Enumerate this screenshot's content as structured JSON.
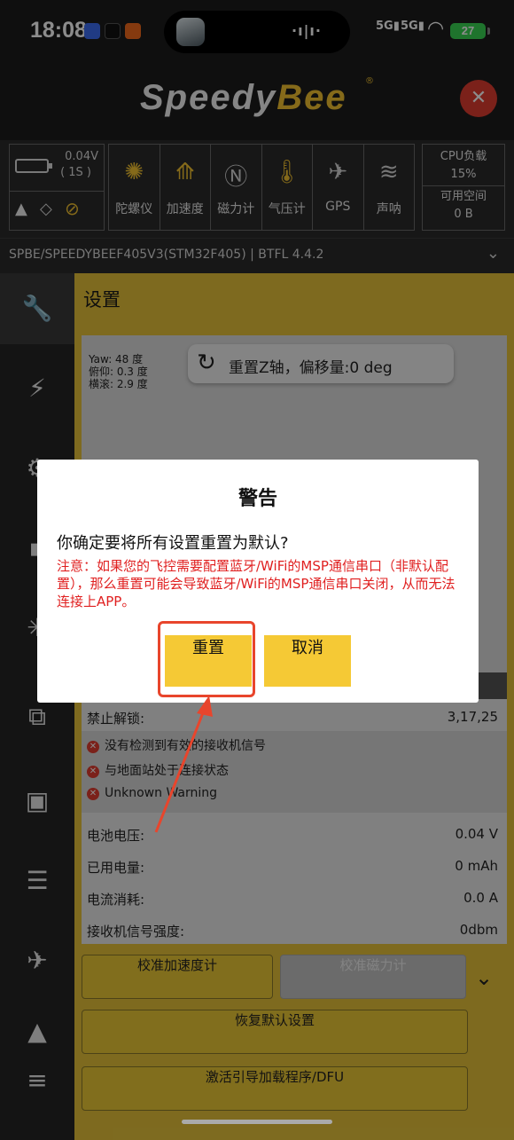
{
  "status": {
    "time": "18:08",
    "signal1": "5G",
    "signal2": "5G",
    "battery": "27"
  },
  "header": {
    "logo_part1": "Speedy",
    "logo_part2": "Bee",
    "logo_reg": "®"
  },
  "sensors": {
    "battery_voltage": "0.04V",
    "battery_cells": "( 1S )",
    "items": [
      {
        "label": "陀螺仪",
        "icon": "gyro-icon",
        "active": true
      },
      {
        "label": "加速度",
        "icon": "accelerometer-icon",
        "active": true
      },
      {
        "label": "磁力计",
        "icon": "compass-icon",
        "active": false
      },
      {
        "label": "气压计",
        "icon": "barometer-icon",
        "active": true
      },
      {
        "label": "GPS",
        "icon": "satellite-icon",
        "active": false
      },
      {
        "label": "声呐",
        "icon": "sonar-icon",
        "active": false
      }
    ],
    "cpu_label": "CPU负载",
    "cpu_value": "15%",
    "space_label": "可用空间",
    "space_value": "0 B"
  },
  "device": {
    "info": "SPBE/SPEEDYBEEF405V3(STM32F405) | BTFL 4.4.2"
  },
  "main": {
    "title": "设置",
    "yaw": "Yaw: 48 度",
    "pitch": "俯仰: 0.3 度",
    "roll": "横滚: 2.9 度",
    "reset_z": "重置Z轴，偏移量:0 deg",
    "arming_label": "禁止解锁:",
    "arming_value": "3,17,25",
    "warnings": [
      "没有检测到有效的接收机信号",
      "与地面站处于连接状态",
      "Unknown Warning"
    ],
    "rows": [
      {
        "k": "电池电压:",
        "v": "0.04 V"
      },
      {
        "k": "已用电量:",
        "v": "0 mAh"
      },
      {
        "k": "电流消耗:",
        "v": "0.0 A"
      },
      {
        "k": "接收机信号强度:",
        "v": "0dbm"
      }
    ],
    "btn_calib_acc": "校准加速度计",
    "btn_calib_mag": "校准磁力计",
    "btn_restore": "恢复默认设置",
    "btn_dfu": "激活引导加载程序/DFU"
  },
  "dialog": {
    "title": "警告",
    "message": "你确定要将所有设置重置为默认?",
    "note": "注意：如果您的飞控需要配置蓝牙/WiFi的MSP通信串口（非默认配置），那么重置可能会导致蓝牙/WiFi的MSP通信串口关闭，从而无法连接上APP。",
    "confirm": "重置",
    "cancel": "取消"
  },
  "colors": {
    "accent": "#e6c23a",
    "danger": "#e03c30",
    "annotation": "#e8452c"
  }
}
